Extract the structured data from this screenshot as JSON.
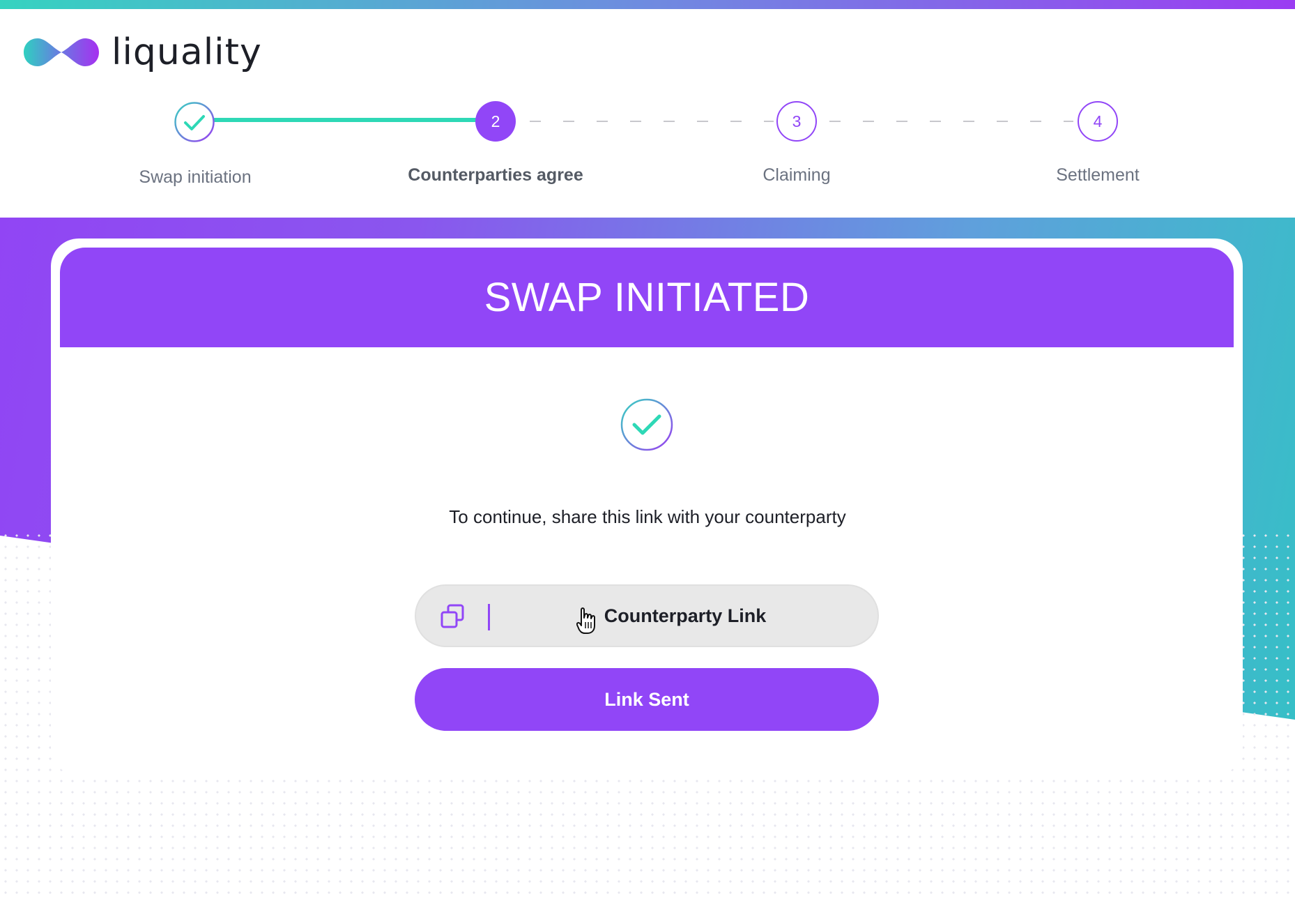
{
  "brand": {
    "name": "liquality",
    "gradient_colors": [
      "#35d3c0",
      "#6f8be0",
      "#9b3cf2"
    ]
  },
  "stepper": {
    "steps": [
      {
        "number": "1",
        "label": "Swap initiation",
        "state": "completed"
      },
      {
        "number": "2",
        "label": "Counterparties agree",
        "state": "active"
      },
      {
        "number": "3",
        "label": "Claiming",
        "state": "pending"
      },
      {
        "number": "4",
        "label": "Settlement",
        "state": "pending"
      }
    ]
  },
  "card": {
    "title": "SWAP INITIATED",
    "status_icon": "check-circle-icon",
    "instruction": "To continue, share this link with your counterparty",
    "link_field": {
      "icon": "copy-icon",
      "label": "Counterparty Link"
    },
    "primary_button": "Link Sent"
  },
  "colors": {
    "accent": "#9146f7",
    "success": "#2ed8b6",
    "text": "#1d1f27",
    "muted_text": "#6b7280",
    "field_bg": "#e8e8e8"
  }
}
